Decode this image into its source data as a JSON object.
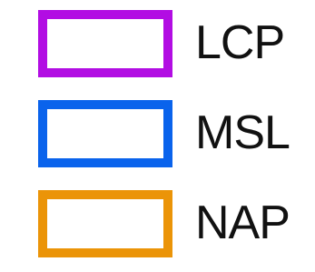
{
  "legend": {
    "items": [
      {
        "label": "LCP",
        "color": "#b20de3"
      },
      {
        "label": "MSL",
        "color": "#0a63ec"
      },
      {
        "label": "NAP",
        "color": "#eb9408"
      }
    ]
  }
}
